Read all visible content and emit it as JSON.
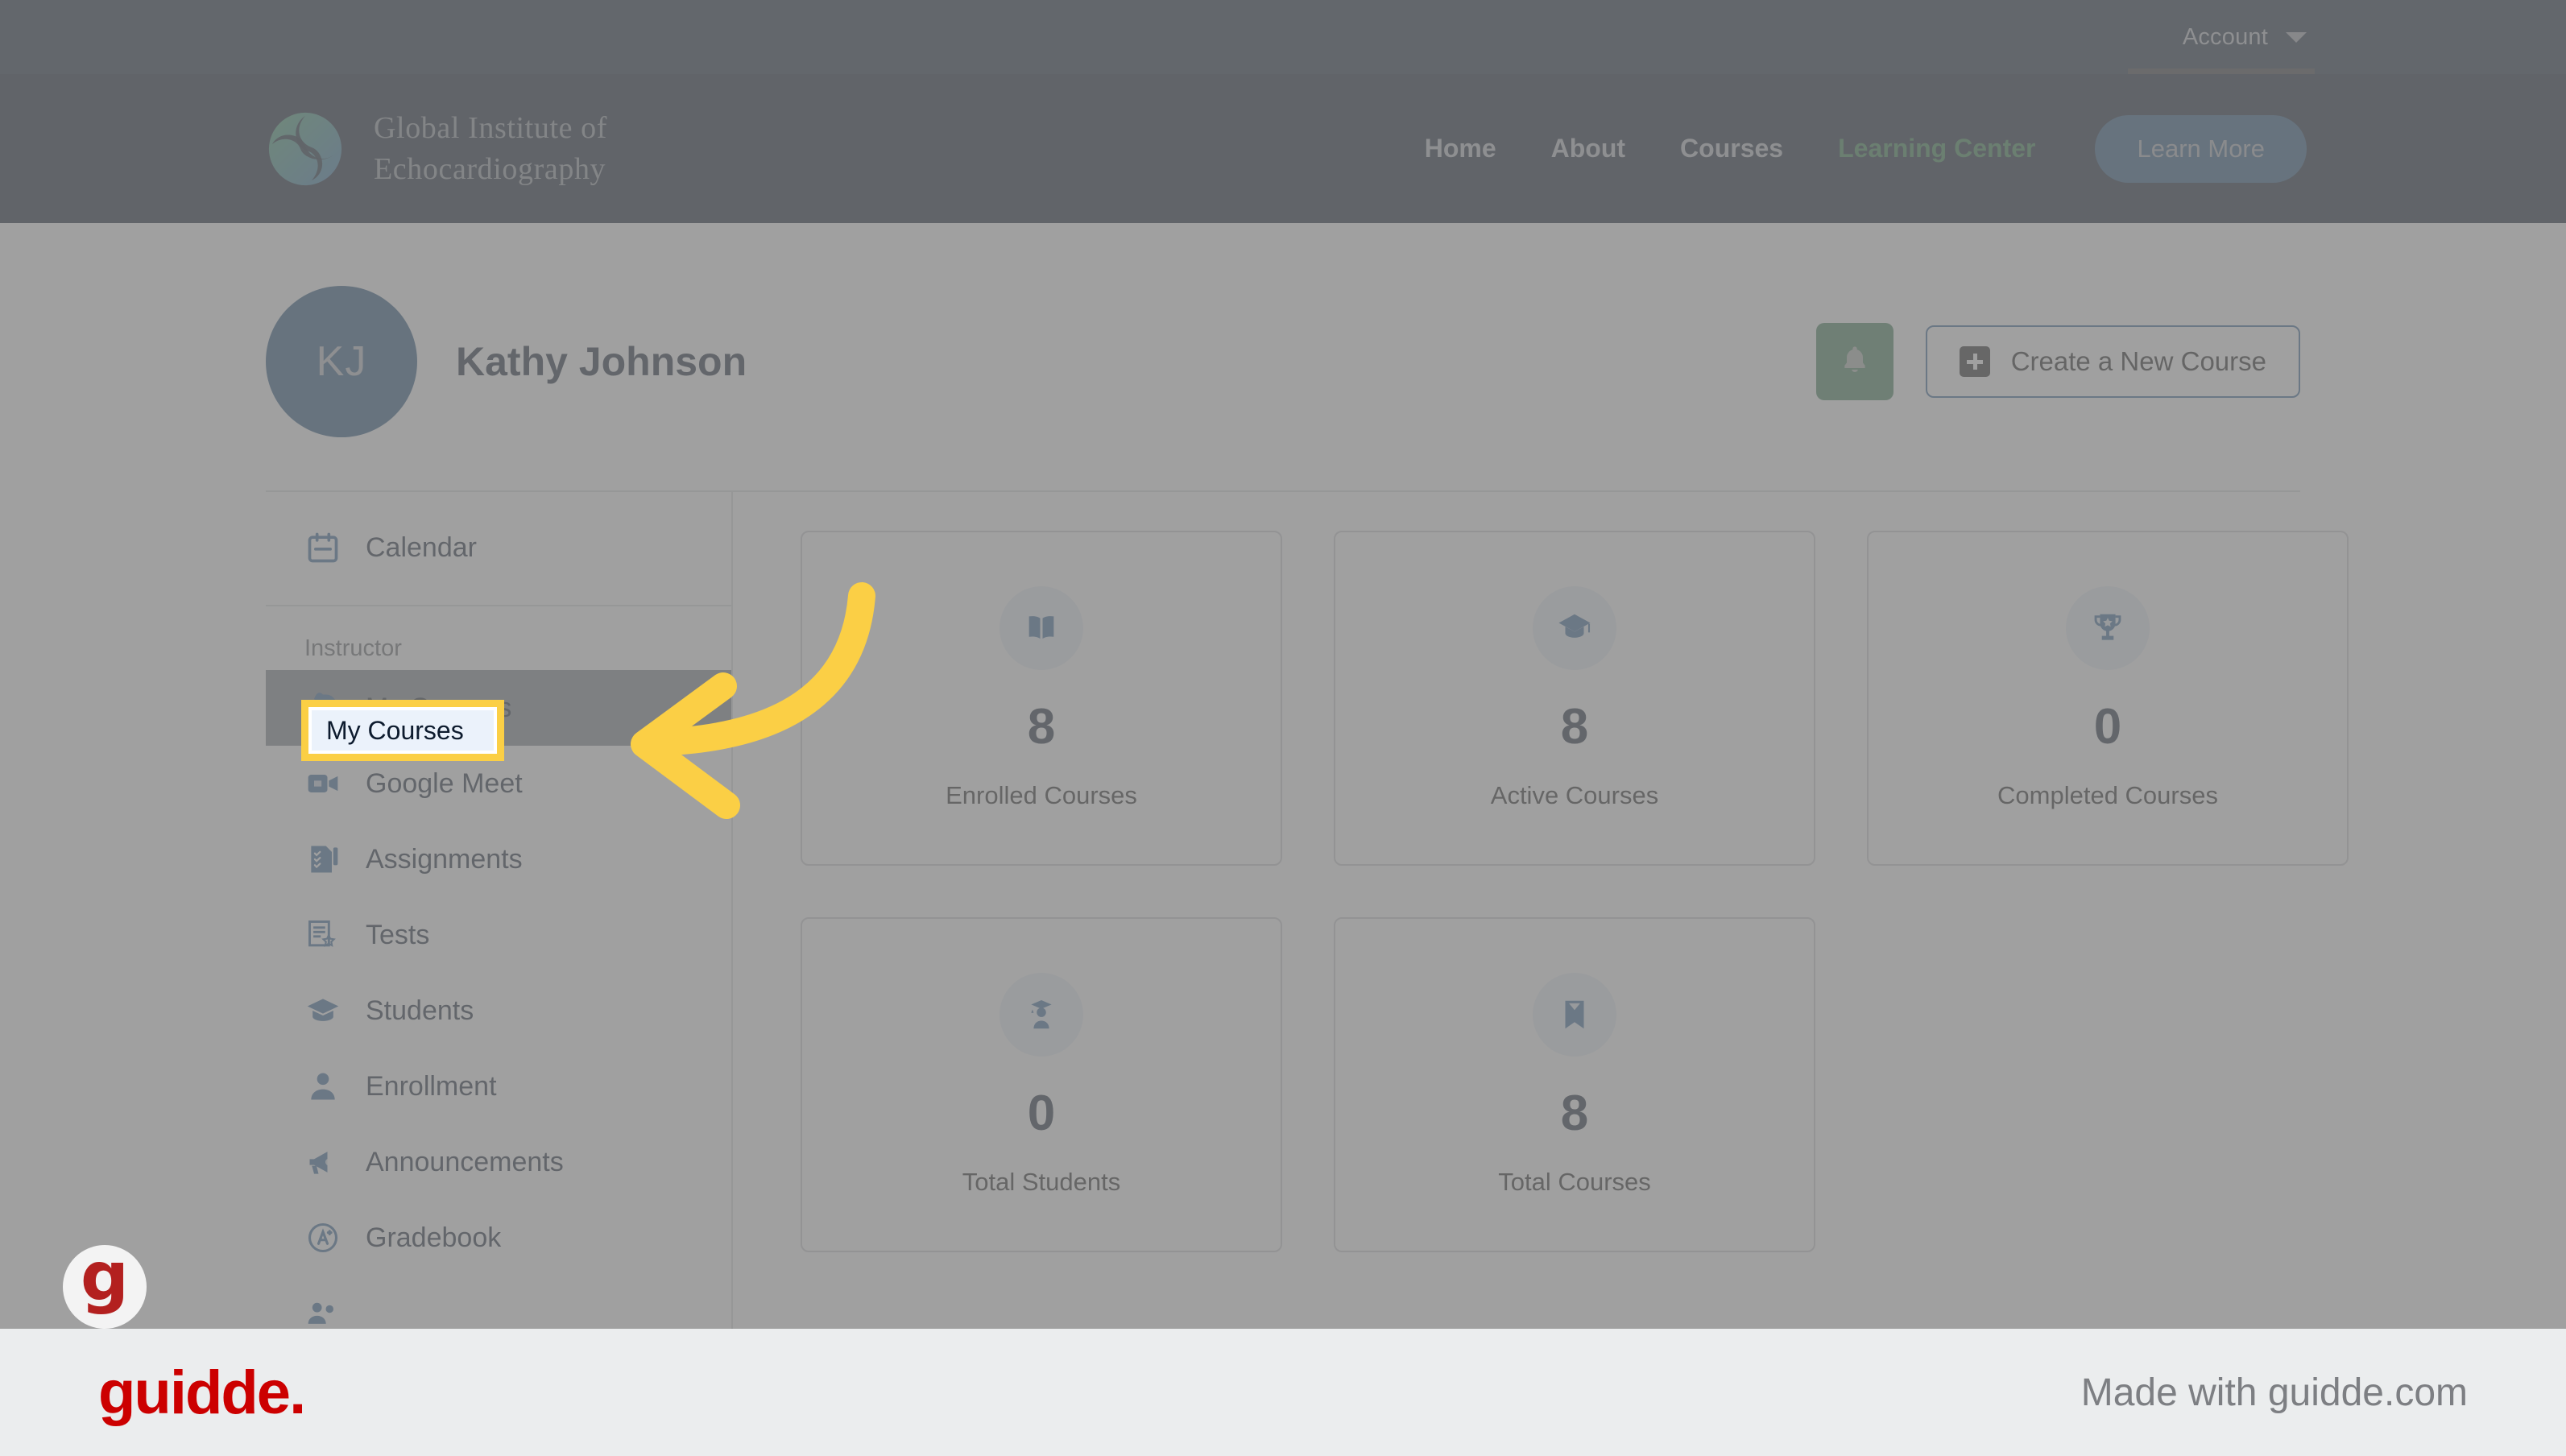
{
  "topbar": {
    "account_label": "Account",
    "account_caret_icon": "chevron-down-icon"
  },
  "nav": {
    "brand": {
      "line1": "Global Institute of",
      "line2": "Echocardiography",
      "logo_icon": "gie-swirl-logo"
    },
    "links": [
      {
        "label": "Home",
        "accent": false
      },
      {
        "label": "About",
        "accent": false
      },
      {
        "label": "Courses",
        "accent": false
      },
      {
        "label": "Learning Center",
        "accent": true
      }
    ],
    "cta_label": "Learn More",
    "accent_color": "#2e7d45",
    "cta_bg": "#1f4e79"
  },
  "profile": {
    "initials": "KJ",
    "name": "Kathy Johnson",
    "avatar_color": "#1f4e79",
    "bell_icon": "bell-icon",
    "bell_color": "#3c7d55",
    "create_label": "Create a New Course",
    "create_icon": "plus-square-icon"
  },
  "sidebar": {
    "top_items": [
      {
        "label": "Calendar",
        "icon": "calendar-icon"
      }
    ],
    "group_label": "Instructor",
    "items": [
      {
        "label": "My Courses",
        "icon": "rocket-icon",
        "active": true
      },
      {
        "label": "Google Meet",
        "icon": "video-camera-icon",
        "active": false
      },
      {
        "label": "Assignments",
        "icon": "checklist-icon",
        "active": false
      },
      {
        "label": "Tests",
        "icon": "test-paper-icon",
        "active": false
      },
      {
        "label": "Students",
        "icon": "graduation-cap-icon",
        "active": false
      },
      {
        "label": "Enrollment",
        "icon": "person-icon",
        "active": false
      },
      {
        "label": "Announcements",
        "icon": "megaphone-icon",
        "active": false
      },
      {
        "label": "Gradebook",
        "icon": "grade-a-icon",
        "active": false
      }
    ]
  },
  "stats": {
    "row1": [
      {
        "value": "8",
        "label": "Enrolled Courses",
        "icon": "open-book-icon"
      },
      {
        "value": "8",
        "label": "Active Courses",
        "icon": "graduation-cap-icon"
      },
      {
        "value": "0",
        "label": "Completed Courses",
        "icon": "trophy-icon"
      }
    ],
    "row2": [
      {
        "value": "0",
        "label": "Total Students",
        "icon": "student-icon"
      },
      {
        "value": "8",
        "label": "Total Courses",
        "icon": "bookmark-icon"
      }
    ]
  },
  "callout": {
    "highlight_label": "My Courses",
    "border_color": "#fbcf45",
    "fill_color": "#ebf2fb",
    "arrow_icon": "curved-left-arrow",
    "arrow_color": "#fbcf45"
  },
  "footer": {
    "logo_text": "guidde.",
    "made_with": "Made with guidde.com",
    "logo_color": "#cc0000",
    "badge_letter": "g"
  }
}
